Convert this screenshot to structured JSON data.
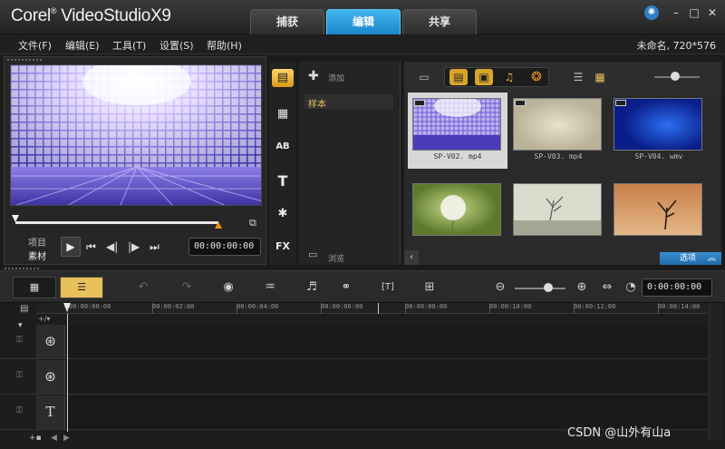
{
  "app": {
    "logo_brand": "Corel",
    "logo_product": "VideoStudio",
    "logo_version": "X9"
  },
  "tabs": [
    {
      "label": "捕获",
      "active": false
    },
    {
      "label": "编辑",
      "active": true
    },
    {
      "label": "共享",
      "active": false
    }
  ],
  "menu": [
    "文件(F)",
    "编辑(E)",
    "工具(T)",
    "设置(S)",
    "帮助(H)"
  ],
  "project_info": "未命名, 720*576",
  "player": {
    "labels": {
      "project": "项目",
      "clip": "素材"
    },
    "timecode": "00:00:00:00"
  },
  "library": {
    "add_label": "添加",
    "folder": "样本",
    "browse_label": "浏览",
    "options_label": "选项",
    "thumbnails": [
      {
        "label": "SP-V02. mp4",
        "selected": true
      },
      {
        "label": "SP-V03. mp4",
        "selected": false
      },
      {
        "label": "SP-V04. wmv",
        "selected": false
      },
      {
        "label": "",
        "selected": false
      },
      {
        "label": "",
        "selected": false
      },
      {
        "label": "",
        "selected": false
      }
    ]
  },
  "timeline": {
    "zoom_timecode": "0:00:00:00",
    "ruler": [
      "00:00:00:00",
      "00:00:02:00",
      "00:00:04:00",
      "00:00:06:00",
      "00:00:08:00",
      "00:00:10:00",
      "00:00:12:00",
      "00:00:14:00"
    ],
    "track_icons": [
      "film-reel-icon",
      "film-reel-icon",
      "title-T-icon"
    ]
  },
  "watermark": "CSDN @山外有山a",
  "colors": {
    "accent_blue": "#1a86c8",
    "library_active": "#d89a18",
    "options_blue": "#1e6aa8"
  }
}
